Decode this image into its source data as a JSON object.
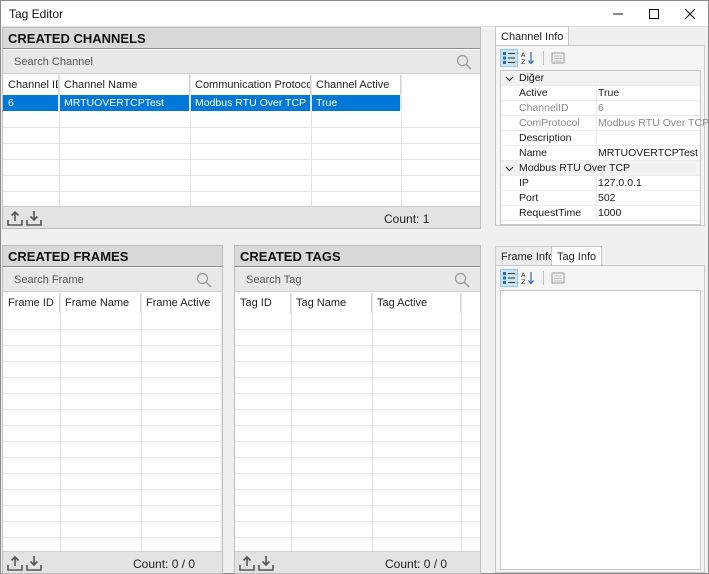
{
  "window": {
    "title": "Tag Editor"
  },
  "channels": {
    "header": "CREATED CHANNELS",
    "search_placeholder": "Search Channel",
    "columns": [
      "Channel ID",
      "Channel Name",
      "Communication Protocol",
      "Channel Active"
    ],
    "rows": [
      {
        "id": "6",
        "name": "MRTUOVERTCPTest",
        "protocol": "Modbus RTU Over TCP",
        "active": "True",
        "selected": true
      }
    ],
    "count": "Count: 1"
  },
  "frames": {
    "header": "CREATED FRAMES",
    "search_placeholder": "Search Frame",
    "columns": [
      "Frame ID",
      "Frame Name",
      "Frame Active"
    ],
    "count": "Count: 0 / 0"
  },
  "tags": {
    "header": "CREATED TAGS",
    "search_placeholder": "Search Tag",
    "columns": [
      "Tag ID",
      "Tag Name",
      "Tag Active"
    ],
    "count": "Count: 0 / 0"
  },
  "channel_info": {
    "tab": "Channel Info",
    "categories": [
      {
        "name": "Diğer",
        "props": [
          {
            "key": "Active",
            "value": "True",
            "readonly": false
          },
          {
            "key": "ChannelID",
            "value": "6",
            "readonly": true
          },
          {
            "key": "ComProtocol",
            "value": "Modbus RTU Over TCP",
            "readonly": true
          },
          {
            "key": "Description",
            "value": "",
            "readonly": false
          },
          {
            "key": "Name",
            "value": "MRTUOVERTCPTest",
            "readonly": false
          }
        ]
      },
      {
        "name": "Modbus RTU Over TCP",
        "props": [
          {
            "key": "IP",
            "value": "127.0.0.1",
            "readonly": false
          },
          {
            "key": "Port",
            "value": "502",
            "readonly": false
          },
          {
            "key": "RequestTime",
            "value": "1000",
            "readonly": false
          }
        ]
      }
    ]
  },
  "lower_info": {
    "tabs": [
      "Frame Info",
      "Tag Info"
    ],
    "active_tab": "Tag Info"
  },
  "icons": {
    "categorized": "categorized-icon",
    "alphabetical": "sort-alpha-icon",
    "property_pages": "property-pages-icon",
    "upload": "upload-icon",
    "download": "download-icon",
    "search": "search-icon"
  },
  "colors": {
    "selection": "#0078d7",
    "header_bg": "#d9d9d9"
  }
}
